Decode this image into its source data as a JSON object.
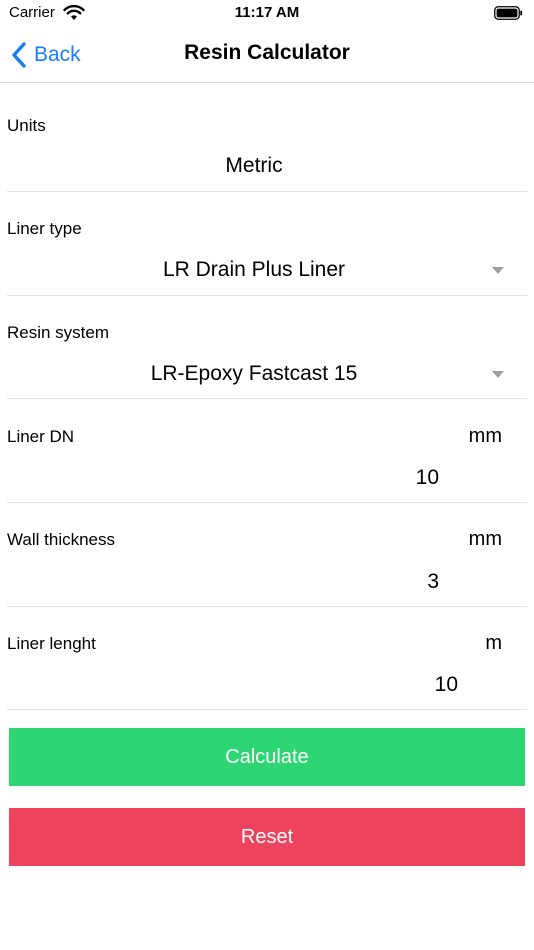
{
  "status_bar": {
    "carrier": "Carrier",
    "time": "11:17 AM"
  },
  "nav": {
    "back_label": "Back",
    "title": "Resin Calculator"
  },
  "form": {
    "units": {
      "label": "Units",
      "value": "Metric"
    },
    "liner_type": {
      "label": "Liner type",
      "value": "LR Drain Plus Liner"
    },
    "resin_system": {
      "label": "Resin system",
      "value": "LR-Epoxy Fastcast 15"
    },
    "liner_dn": {
      "label": "Liner DN",
      "unit": "mm",
      "value": "10"
    },
    "wall_thickness": {
      "label": "Wall thickness",
      "unit": "mm",
      "value": "3"
    },
    "liner_length": {
      "label": "Liner lenght",
      "unit": "m",
      "value": "10"
    }
  },
  "buttons": {
    "calculate": "Calculate",
    "reset": "Reset"
  },
  "colors": {
    "accent": "#1a7cf6",
    "calculate": "#2ed573",
    "reset": "#ed435d"
  },
  "icons": [
    "wifi-icon",
    "battery-icon",
    "chevron-left-icon",
    "dropdown-caret-icon"
  ]
}
